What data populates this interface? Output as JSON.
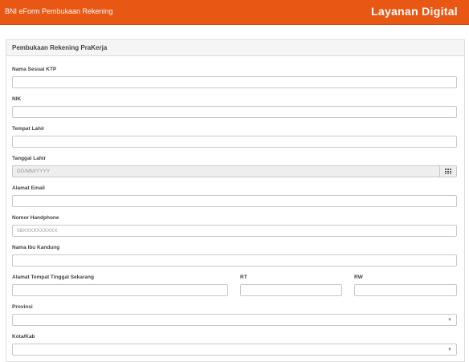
{
  "header": {
    "app_title": "BNI eForm Pembukaan Rekening",
    "brand": "Layanan Digital"
  },
  "panel": {
    "title": "Pembukaan Rekening PraKerja"
  },
  "form": {
    "nama_label": "Nama Sesuai KTP",
    "nik_label": "NIK",
    "tempat_lahir_label": "Tempat Lahir",
    "tanggal_lahir_label": "Tanggal Lahir",
    "tanggal_lahir_placeholder": "DD/MM/YYYY",
    "email_label": "Alamat Email",
    "hp_label": "Nomor Handphone",
    "hp_placeholder": "08XXXXXXXXXX",
    "ibu_label": "Nama Ibu Kandung",
    "alamat_label": "Alamat Tempat Tinggal Sekarang",
    "rt_label": "RT",
    "rw_label": "RW",
    "provinsi_label": "Provinsi",
    "kota_label": "Kota/Kab"
  },
  "colors": {
    "accent": "#e85713"
  },
  "icons": {
    "calendar": "calendar-icon",
    "dropdown": "chevron-down-icon"
  }
}
